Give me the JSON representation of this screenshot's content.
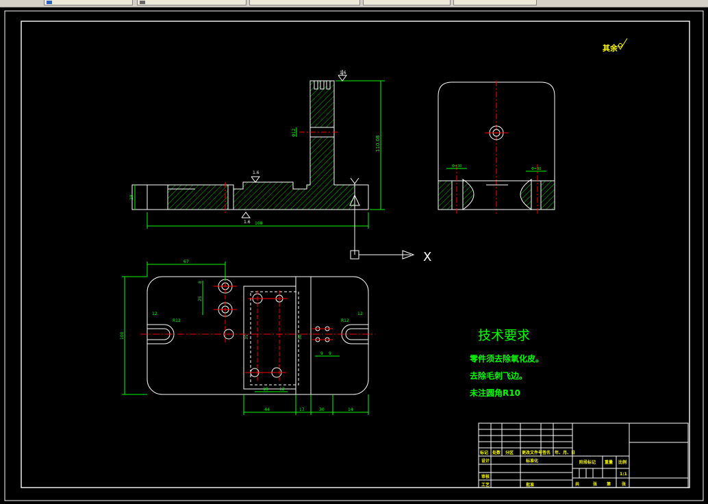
{
  "tabs": [
    "",
    "",
    "",
    "",
    "",
    "",
    ""
  ],
  "drawing": {
    "roughness_label": "其余",
    "tech_title": "技术要求",
    "tech_lines": [
      "零件须去除氧化皮。",
      "去除毛刺飞边。",
      "未注圆角R10"
    ],
    "ucs": {
      "x_label": "X",
      "y_label": "Y"
    },
    "front_dims": {
      "overall_length": "108",
      "height": "110.08",
      "left_height": "28",
      "flatness_top": "1.6",
      "flatness_mid": "1.6",
      "flatness_bottom": "1.6",
      "slot": "Φ12"
    },
    "side_dims": {
      "left": "Φ=30",
      "right": "Φ=30"
    },
    "plan_dims": {
      "top": "67",
      "overall_height": "100",
      "r_left": "R12",
      "r_right": "R12",
      "w_left": "12",
      "w_right": "12",
      "b1": "44",
      "b2": "17",
      "b3": "30",
      "b4": "14",
      "c1": "18",
      "c2": "12",
      "d1": "9",
      "d2": "9",
      "v1": "8",
      "v2": "25",
      "v3": "35",
      "v4": "30"
    }
  },
  "title_block": {
    "row_labels": [
      "标记",
      "处数",
      "分区",
      "更改文件号",
      "签名",
      "年、月、日"
    ],
    "design": "设计",
    "standardize": "标准化",
    "review": "审核",
    "process": "工艺",
    "approve": "批准",
    "stage_mark": "阶段标记",
    "weight": "重量",
    "scale": "比例",
    "scale_value": "1:1",
    "sheet_total": "共",
    "sheet_unit": "张",
    "sheet_no": "第",
    "sheet_unit2": "张"
  }
}
